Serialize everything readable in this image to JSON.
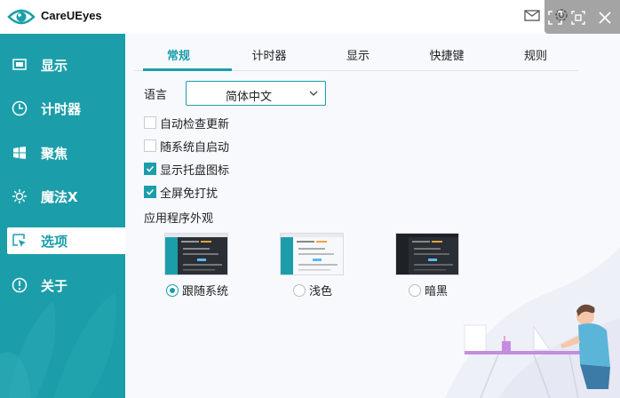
{
  "app": {
    "title": "CareUEyes"
  },
  "colors": {
    "accent": "#1b9eaa",
    "sidebar_bg": "#1b9eaa",
    "main_bg": "#f8f9fd"
  },
  "titlebar_icons": [
    "mail-icon",
    "settings-icon",
    "fullscreen-icon",
    "crop-icon",
    "close-icon"
  ],
  "sidebar": {
    "items": [
      {
        "label": "显示",
        "icon": "monitor-icon",
        "active": false
      },
      {
        "label": "计时器",
        "icon": "clock-icon",
        "active": false
      },
      {
        "label": "聚焦",
        "icon": "windows-icon",
        "active": false
      },
      {
        "label": "魔法X",
        "icon": "sun-icon",
        "active": false
      },
      {
        "label": "选项",
        "icon": "cursor-icon",
        "active": true
      },
      {
        "label": "关于",
        "icon": "info-icon",
        "active": false
      }
    ]
  },
  "tabs": [
    {
      "label": "常规",
      "active": true
    },
    {
      "label": "计时器",
      "active": false
    },
    {
      "label": "显示",
      "active": false
    },
    {
      "label": "快捷键",
      "active": false
    },
    {
      "label": "规则",
      "active": false
    }
  ],
  "general": {
    "language_label": "语言",
    "language_value": "简体中文",
    "checkboxes": [
      {
        "label": "自动检查更新",
        "checked": false
      },
      {
        "label": "随系统自启动",
        "checked": false
      },
      {
        "label": "显示托盘图标",
        "checked": true
      },
      {
        "label": "全屏免打扰",
        "checked": true
      }
    ],
    "appearance_title": "应用程序外观",
    "themes": [
      {
        "label": "跟随系统",
        "selected": true
      },
      {
        "label": "浅色",
        "selected": false
      },
      {
        "label": "暗黑",
        "selected": false
      }
    ]
  }
}
